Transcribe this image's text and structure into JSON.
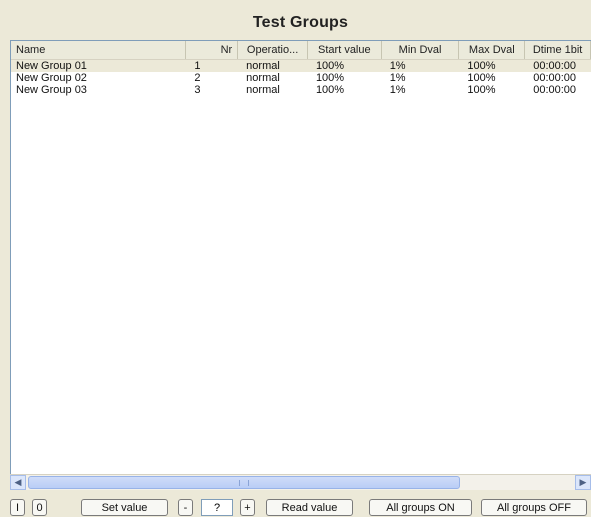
{
  "title": "Test Groups",
  "columns": [
    "Name",
    "Nr",
    "Operatio...",
    "Start value",
    "Min Dval",
    "Max Dval",
    "Dtime 1bit"
  ],
  "rows": [
    {
      "name": "New Group 01",
      "nr": "1",
      "op": "normal",
      "start": "100%",
      "min": "1%",
      "max": "100%",
      "dt": "00:00:00"
    },
    {
      "name": "New Group 02",
      "nr": "2",
      "op": "normal",
      "start": "100%",
      "min": "1%",
      "max": "100%",
      "dt": "00:00:00"
    },
    {
      "name": "New Group 03",
      "nr": "3",
      "op": "normal",
      "start": "100%",
      "min": "1%",
      "max": "100%",
      "dt": "00:00:00"
    }
  ],
  "scroll": {
    "left_icon": "scroll-left-icon",
    "right_icon": "scroll-right-icon"
  },
  "toolbar": {
    "on_label": "I",
    "off_label": "0",
    "set_value_label": "Set value",
    "minus_label": "-",
    "value_field": "?",
    "plus_label": "+",
    "read_value_label": "Read value",
    "all_on_label": "All groups ON",
    "all_off_label": "All groups OFF"
  }
}
